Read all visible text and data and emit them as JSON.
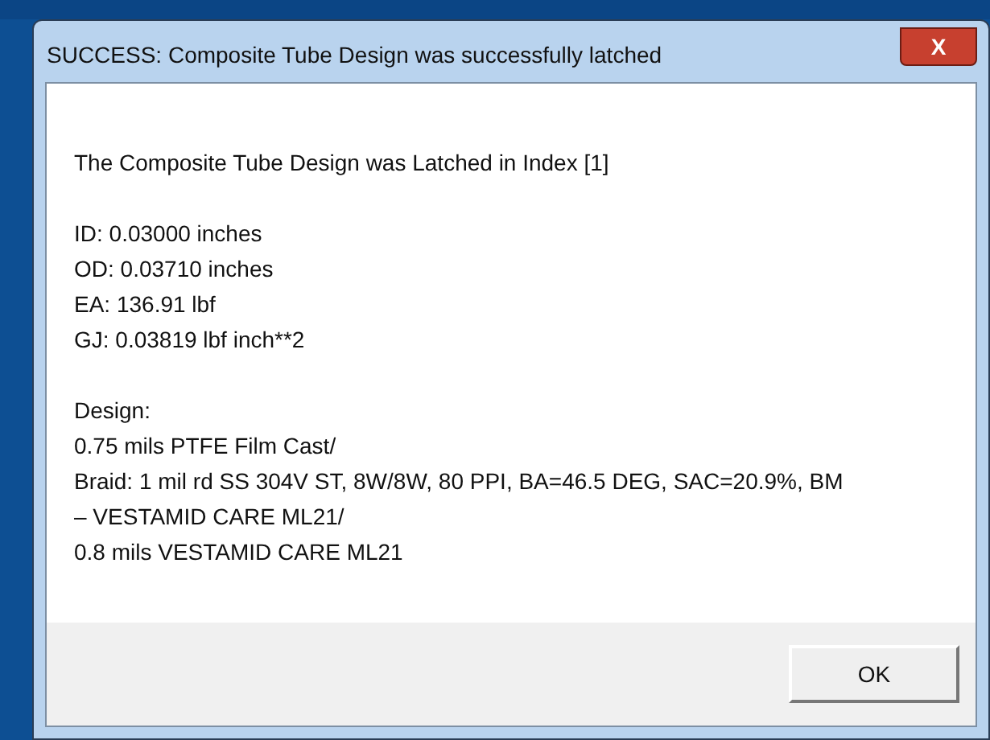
{
  "window": {
    "title": "SUCCESS: Composite Tube Design was successfully latched",
    "close": "X"
  },
  "message": {
    "heading": "The Composite Tube Design was Latched in Index [1]",
    "properties": [
      "ID: 0.03000 inches",
      "OD: 0.03710 inches",
      "EA: 136.91 lbf",
      "GJ: 0.03819 lbf inch**2"
    ],
    "design_label": "Design:",
    "design_lines": [
      "0.75 mils PTFE Film Cast/",
      "Braid: 1 mil rd SS 304V ST, 8W/8W, 80 PPI, BA=46.5 DEG, SAC=20.9%, BM",
      "– VESTAMID CARE ML21/",
      "0.8 mils VESTAMID CARE ML21"
    ]
  },
  "buttons": [
    "OK"
  ]
}
